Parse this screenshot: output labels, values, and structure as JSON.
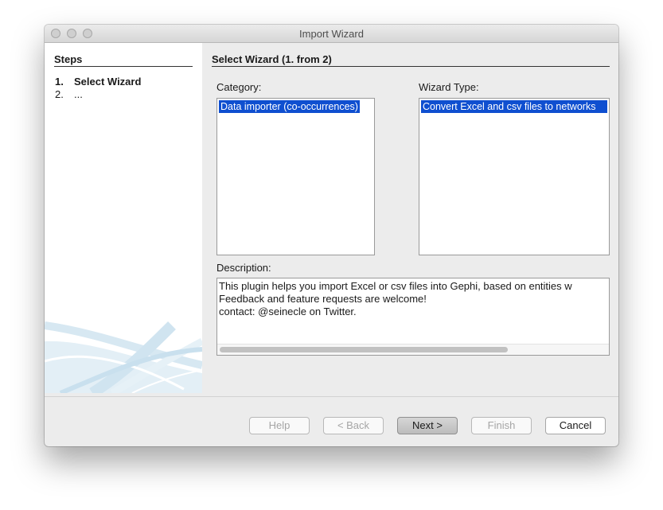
{
  "window": {
    "title": "Import Wizard"
  },
  "steps": {
    "heading": "Steps",
    "items": [
      {
        "number": "1.",
        "label": "Select Wizard",
        "current": true
      },
      {
        "number": "2.",
        "label": "...",
        "current": false
      }
    ]
  },
  "content": {
    "heading": "Select Wizard (1. from 2)",
    "category_label": "Category:",
    "categories": [
      "Data importer (co-occurrences)"
    ],
    "wizard_type_label": "Wizard Type:",
    "wizard_types": [
      "Convert Excel and csv files to networks"
    ],
    "description_label": "Description:",
    "description_lines": [
      "This plugin helps you import Excel or csv files into Gephi, based on entities w",
      " Feedback and feature requests are welcome!",
      " contact: @seinecle on Twitter."
    ]
  },
  "buttons": {
    "help": "Help",
    "back": "< Back",
    "next": "Next >",
    "finish": "Finish",
    "cancel": "Cancel"
  },
  "colors": {
    "selection": "#0f4fd0",
    "window_background": "#ececec",
    "panel_background": "#ffffff"
  }
}
